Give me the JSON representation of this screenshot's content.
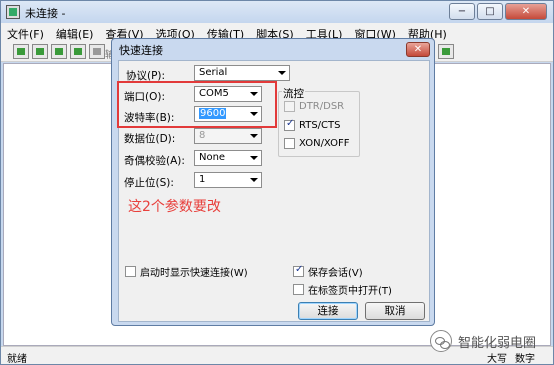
{
  "window": {
    "title": "未连接 -",
    "controls": {
      "minimize": "−",
      "maximize": "□",
      "close": "✕"
    }
  },
  "menubar": [
    "文件(F)",
    "编辑(E)",
    "查看(V)",
    "选项(O)",
    "传输(T)",
    "脚本(S)",
    "工具(L)",
    "窗口(W)",
    "帮助(H)"
  ],
  "toolbar": {
    "partial_label": "输"
  },
  "statusbar": {
    "left": "就绪",
    "right": [
      "大写",
      "数字"
    ]
  },
  "dialog": {
    "title": "快速连接",
    "close": "✕",
    "protocol": {
      "label": "协议(P):",
      "value": "Serial"
    },
    "port": {
      "label": "端口(O):",
      "value": "COM5"
    },
    "baud": {
      "label": "波特率(B):",
      "value": "9600"
    },
    "databits": {
      "label": "数据位(D):",
      "value": "8"
    },
    "parity": {
      "label": "奇偶校验(A):",
      "value": "None"
    },
    "stopbits": {
      "label": "停止位(S):",
      "value": "1"
    },
    "flow": {
      "title": "流控",
      "dtr": {
        "label": "DTR/DSR",
        "checked": false
      },
      "rts": {
        "label": "RTS/CTS",
        "checked": true
      },
      "xon": {
        "label": "XON/XOFF",
        "checked": false
      }
    },
    "show_on_start": {
      "label": "启动时显示快速连接(W)",
      "checked": false
    },
    "save_session": {
      "label": "保存会话(V)",
      "checked": true
    },
    "open_in_tab": {
      "label": "在标签页中打开(T)",
      "checked": false
    },
    "connect_btn": "连接",
    "cancel_btn": "取消"
  },
  "annotation": {
    "text": "这2个参数要改",
    "color": "#e8403c"
  },
  "watermark": {
    "text": "智能化弱电圈"
  },
  "colors": {
    "accent": "#3399ff",
    "highlight": "#e23a3a"
  }
}
